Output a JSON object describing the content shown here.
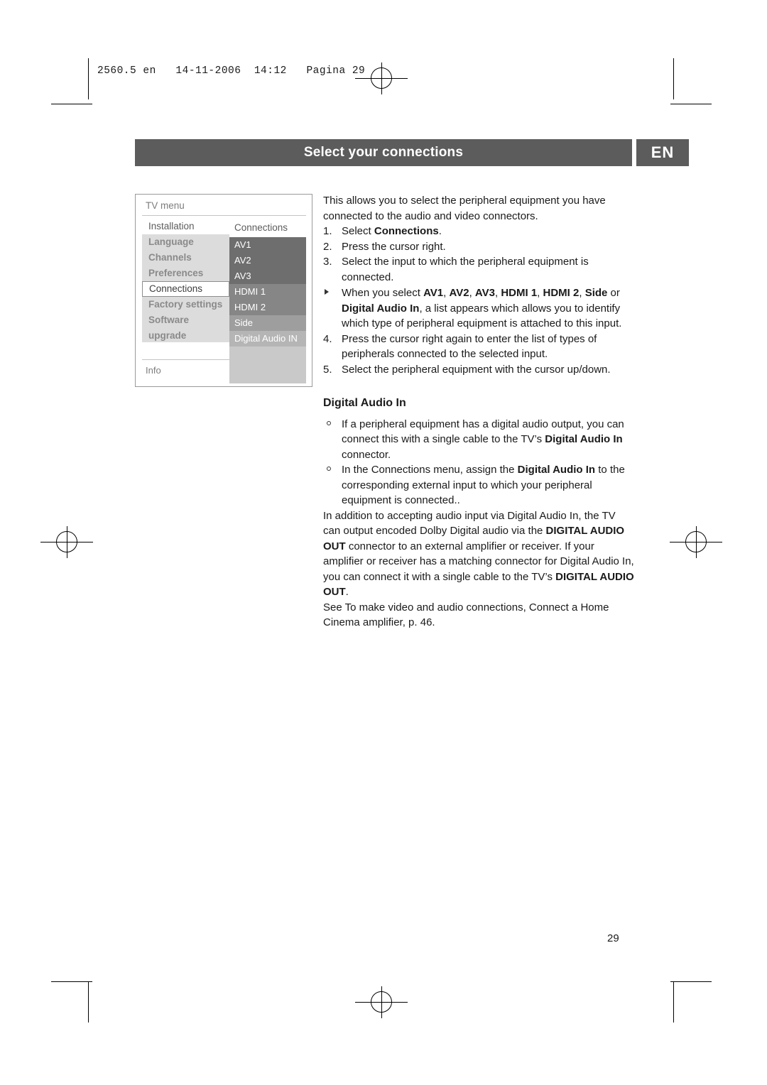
{
  "header": {
    "print_line": "2560.5 en   14-11-2006  14:12   Pagina 29"
  },
  "title_bar": {
    "title": "Select your connections",
    "lang_badge": "EN"
  },
  "tv_menu": {
    "title": "TV menu",
    "info_label": "Info",
    "left_items": [
      {
        "label": "Installation",
        "state": "plain"
      },
      {
        "label": "Language",
        "state": "shaded"
      },
      {
        "label": "Channels",
        "state": "shaded"
      },
      {
        "label": "Preferences",
        "state": "shaded"
      },
      {
        "label": "Connections",
        "state": "selected"
      },
      {
        "label": "Factory settings",
        "state": "shaded"
      },
      {
        "label": "Software upgrade",
        "state": "shaded"
      }
    ],
    "right_header": "Connections",
    "right_items": [
      {
        "label": "AV1",
        "shade": "dark"
      },
      {
        "label": "AV2",
        "shade": "dark"
      },
      {
        "label": "AV3",
        "shade": "dark"
      },
      {
        "label": "HDMI 1",
        "shade": "mid"
      },
      {
        "label": "HDMI 2",
        "shade": "mid"
      },
      {
        "label": "Side",
        "shade": "light"
      },
      {
        "label": "Digital Audio IN",
        "shade": "pale"
      }
    ]
  },
  "main": {
    "intro": "This allows you to select the peripheral equipment you have connected to the audio and video connectors.",
    "steps": [
      {
        "num": "1.",
        "text_html": "Select <b>Connections</b>."
      },
      {
        "num": "2.",
        "text_html": "Press the cursor right."
      },
      {
        "num": "3.",
        "text_html": "Select the input to which the peripheral equipment is connected."
      },
      {
        "num": "4.",
        "text_html": "Press the cursor right again to enter the list of types of peripherals connected to the selected input."
      },
      {
        "num": "5.",
        "text_html": "Select the peripheral equipment with the cursor up/down."
      }
    ],
    "sub_bullet_html": "When you select <b>AV1</b>, <b>AV2</b>, <b>AV3</b>, <b>HDMI 1</b>, <b>HDMI 2</b>, <b>Side</b> or <b>Digital Audio In</b>, a list appears which allows you to identify which type of peripheral equipment is attached to this input.",
    "section_heading": "Digital Audio In",
    "o_bullets": [
      "If a peripheral equipment has a digital audio output, you can connect this with a single cable to the TV’s <b>Digital Audio In</b> connector.",
      "In the Connections menu, assign the <b>Digital Audio In</b> to the corresponding external input to which your peripheral equipment is connected.."
    ],
    "closing_paragraph_html": "In addition to accepting audio input via Digital Audio In, the TV can output encoded Dolby Digital audio via the <b>DIGITAL AUDIO OUT</b> connector to an external amplifier or receiver. If your amplifier or receiver has a matching connector for Digital Audio In, you can connect it with a single cable to the TV’s <b>DIGITAL AUDIO OUT</b>.",
    "see_also_html": "See To make video and audio connections, Connect a Home Cinema amplifier, p. 46."
  },
  "footer": {
    "page_number": "29"
  }
}
